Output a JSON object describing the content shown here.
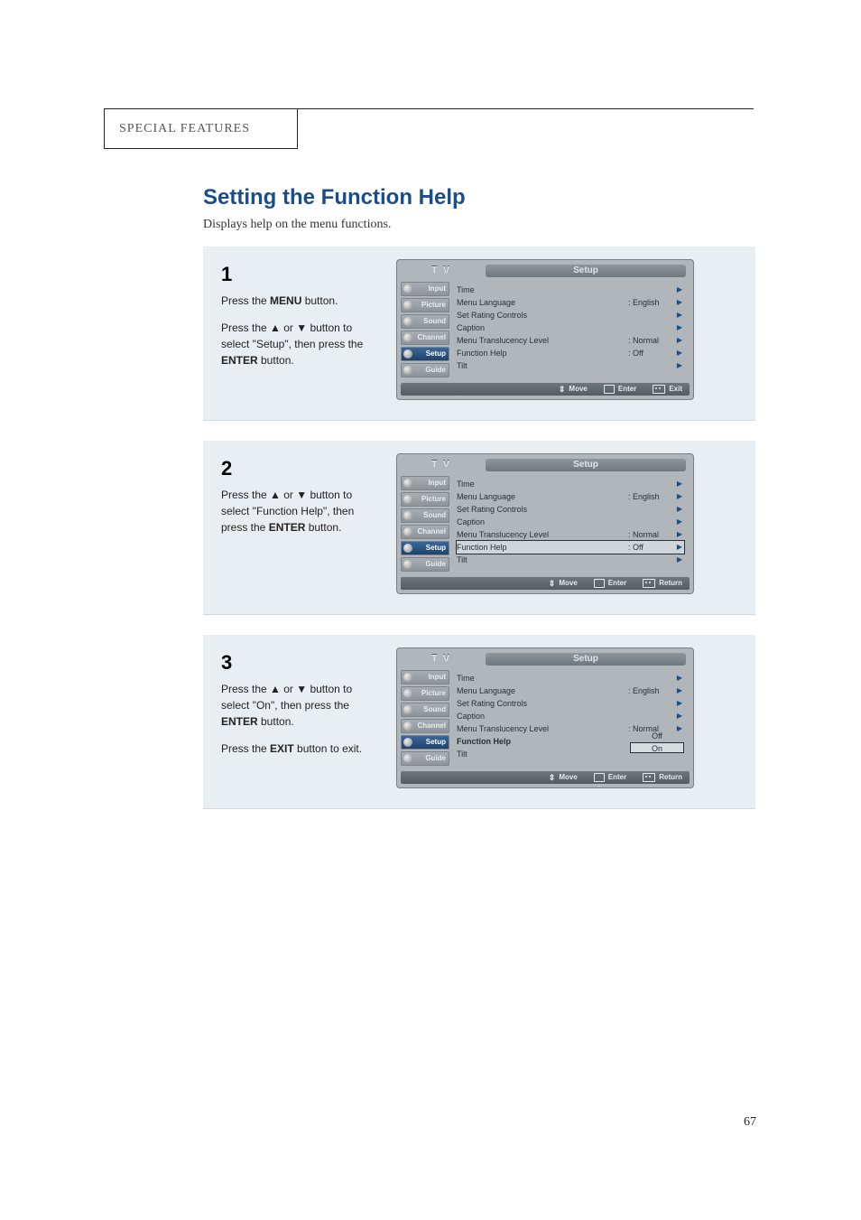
{
  "header": {
    "section": "SPECIAL FEATURES"
  },
  "title": "Setting the Function Help",
  "intro": "Displays help on the menu functions.",
  "page_no": "67",
  "steps": [
    {
      "num": "1",
      "paras": [
        [
          {
            "t": "Press the "
          },
          {
            "b": true,
            "t": "MENU"
          },
          {
            "t": " button."
          }
        ],
        [
          {
            "t": "Press the ▲ or ▼ button to select \"Setup\", then press the "
          },
          {
            "b": true,
            "t": "ENTER"
          },
          {
            "t": " button."
          }
        ]
      ],
      "osd": {
        "tv": "T V",
        "title": "Setup",
        "tabs": [
          {
            "label": "Input"
          },
          {
            "label": "Picture"
          },
          {
            "label": "Sound"
          },
          {
            "label": "Channel"
          },
          {
            "label": "Setup",
            "active": true
          },
          {
            "label": "Guide"
          }
        ],
        "items": [
          {
            "label": "Time",
            "val": "",
            "ar": true
          },
          {
            "label": "Menu Language",
            "val": ": English",
            "ar": true
          },
          {
            "label": "Set Rating Controls",
            "val": "",
            "ar": true
          },
          {
            "label": "Caption",
            "val": "",
            "ar": true
          },
          {
            "label": "Menu Translucency Level",
            "val": ": Normal",
            "ar": true
          },
          {
            "label": "Function Help",
            "val": ": Off",
            "ar": true
          },
          {
            "label": "Tilt",
            "val": "",
            "ar": true
          }
        ],
        "footer": [
          {
            "sym": "updown",
            "t": "Move"
          },
          {
            "sym": "enter",
            "t": "Enter"
          },
          {
            "sym": "menu",
            "t": "Exit"
          }
        ]
      }
    },
    {
      "num": "2",
      "paras": [
        [
          {
            "t": "Press the ▲ or ▼ button to select \"Function Help\", then press the "
          },
          {
            "b": true,
            "t": "ENTER"
          },
          {
            "t": " button."
          }
        ]
      ],
      "osd": {
        "tv": "T V",
        "title": "Setup",
        "tabs": [
          {
            "label": "Input"
          },
          {
            "label": "Picture"
          },
          {
            "label": "Sound"
          },
          {
            "label": "Channel"
          },
          {
            "label": "Setup",
            "active": true
          },
          {
            "label": "Guide"
          }
        ],
        "items": [
          {
            "label": "Time",
            "val": "",
            "ar": true
          },
          {
            "label": "Menu Language",
            "val": ": English",
            "ar": true
          },
          {
            "label": "Set Rating Controls",
            "val": "",
            "ar": true
          },
          {
            "label": "Caption",
            "val": "",
            "ar": true
          },
          {
            "label": "Menu Translucency Level",
            "val": ": Normal",
            "ar": true
          },
          {
            "label": "Function Help",
            "val": ": Off",
            "ar": true,
            "hl": true
          },
          {
            "label": "Tilt",
            "val": "",
            "ar": true
          }
        ],
        "footer": [
          {
            "sym": "updown",
            "t": "Move"
          },
          {
            "sym": "enter",
            "t": "Enter"
          },
          {
            "sym": "menu",
            "t": "Return"
          }
        ]
      }
    },
    {
      "num": "3",
      "paras": [
        [
          {
            "t": "Press the ▲ or ▼ button to select \"On\", then press the "
          },
          {
            "b": true,
            "t": "ENTER"
          },
          {
            "t": " button."
          }
        ],
        [
          {
            "t": "Press the "
          },
          {
            "b": true,
            "t": "EXIT"
          },
          {
            "t": " button to exit."
          }
        ]
      ],
      "osd": {
        "tv": "T V",
        "title": "Setup",
        "tabs": [
          {
            "label": "Input"
          },
          {
            "label": "Picture"
          },
          {
            "label": "Sound"
          },
          {
            "label": "Channel"
          },
          {
            "label": "Setup",
            "active": true
          },
          {
            "label": "Guide"
          }
        ],
        "items": [
          {
            "label": "Time",
            "val": "",
            "ar": true
          },
          {
            "label": "Menu Language",
            "val": ": English",
            "ar": true
          },
          {
            "label": "Set Rating Controls",
            "val": "",
            "ar": true
          },
          {
            "label": "Caption",
            "val": "",
            "ar": true
          },
          {
            "label": "Menu Translucency Level",
            "val": ": Normal",
            "ar": true
          },
          {
            "label": "Function Help",
            "val": "",
            "ar": false,
            "bold": true,
            "options": [
              {
                "t": "Off"
              },
              {
                "t": "On",
                "sel": true
              }
            ]
          },
          {
            "label": "Tilt",
            "val": "",
            "ar": false
          }
        ],
        "footer": [
          {
            "sym": "updown",
            "t": "Move"
          },
          {
            "sym": "enter",
            "t": "Enter"
          },
          {
            "sym": "menu",
            "t": "Return"
          }
        ]
      }
    }
  ]
}
